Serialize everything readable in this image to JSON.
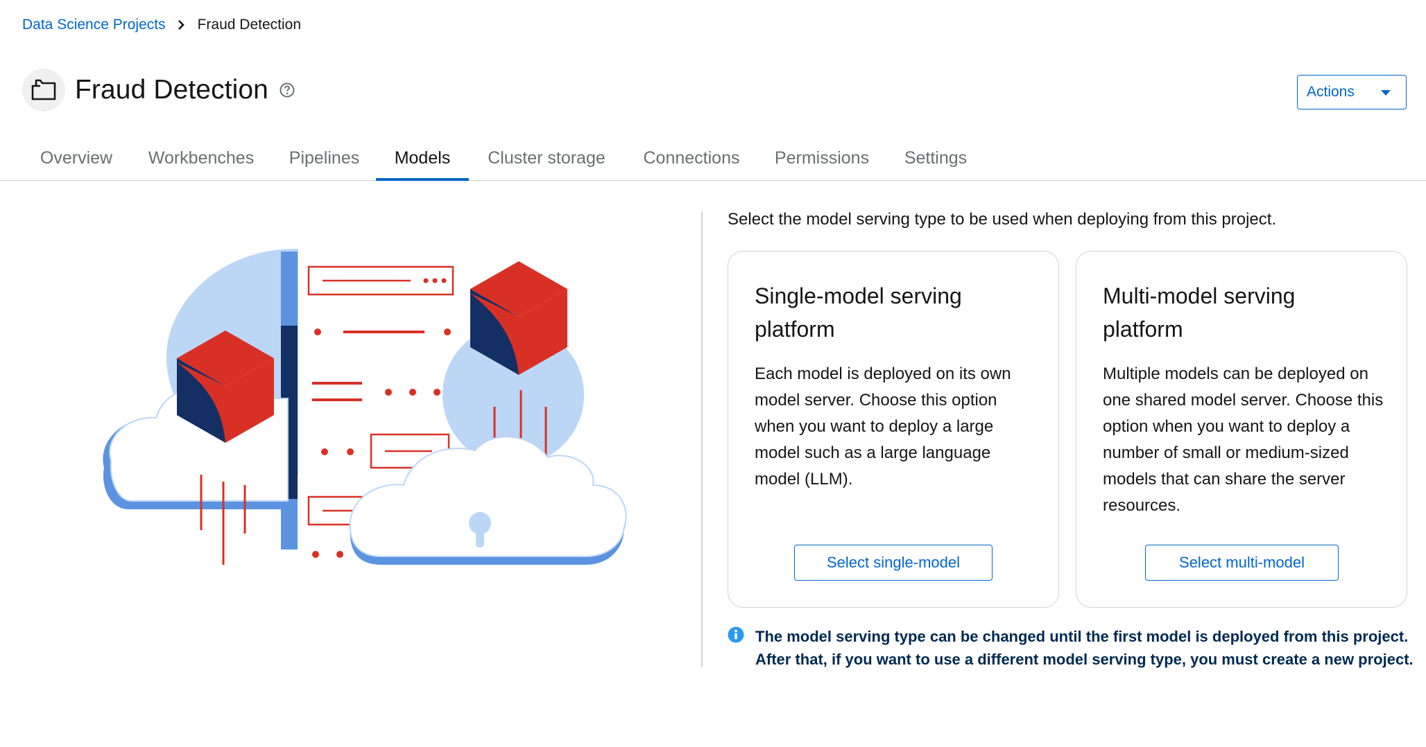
{
  "breadcrumb": {
    "parent": "Data Science Projects",
    "current": "Fraud Detection"
  },
  "header": {
    "title": "Fraud Detection",
    "actions_label": "Actions"
  },
  "tabs": [
    {
      "label": "Overview"
    },
    {
      "label": "Workbenches"
    },
    {
      "label": "Pipelines"
    },
    {
      "label": "Models",
      "active": true
    },
    {
      "label": "Cluster storage"
    },
    {
      "label": "Connections"
    },
    {
      "label": "Permissions"
    },
    {
      "label": "Settings"
    }
  ],
  "models": {
    "intro": "Select the model serving type to be used when deploying from this project.",
    "cards": [
      {
        "title": "Single-model serving platform",
        "body": "Each model is deployed on its own model server. Choose this option when you want to deploy a large model such as a large language model (LLM).",
        "button": "Select single-model"
      },
      {
        "title": "Multi-model serving platform",
        "body": "Multiple models can be deployed on one shared model server. Choose this option when you want to deploy a number of small or medium-sized models that can share the server resources.",
        "button": "Select multi-model"
      }
    ],
    "note": "The model serving type can be changed until the first model is deployed from this project. After that, if you want to use a different model serving type, you must create a new project."
  },
  "colors": {
    "accent": "#0066cc",
    "illustration_red": "#d93025",
    "illustration_navy": "#142f63",
    "illustration_blue": "#5b93e0",
    "illustration_light_blue": "#bcd6f6"
  },
  "icons": [
    "chevron-right-icon",
    "project-folder-icon",
    "help-icon",
    "caret-down-icon",
    "info-icon",
    "cloud-lock-icon"
  ]
}
